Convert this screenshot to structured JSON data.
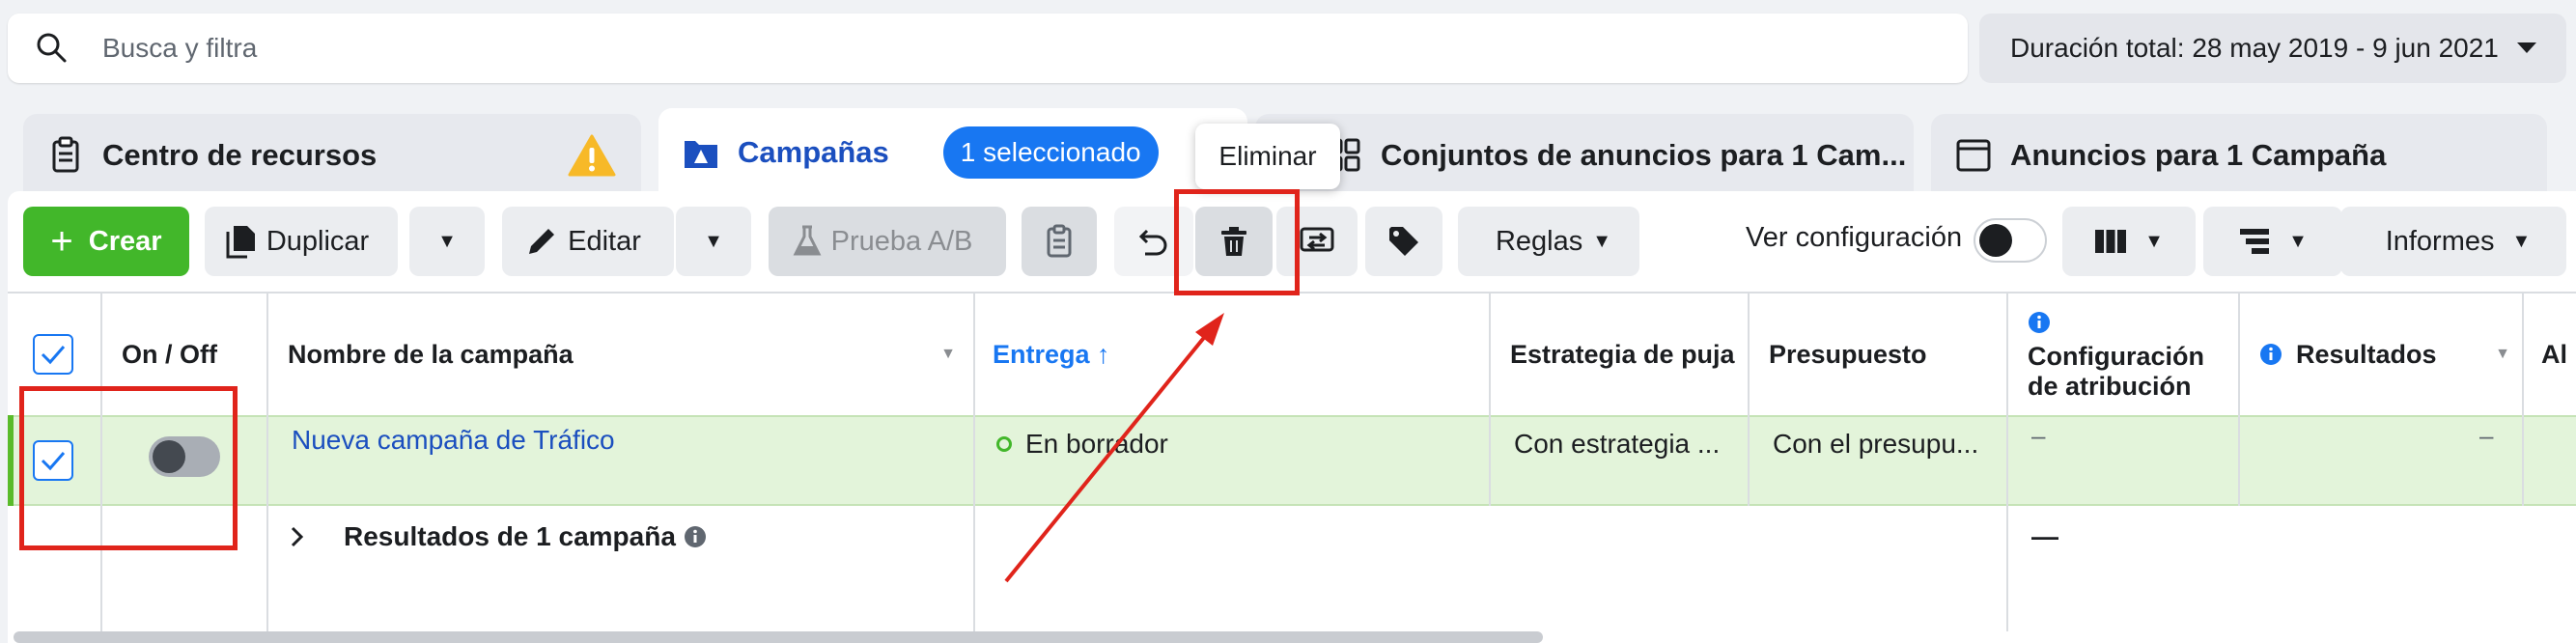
{
  "search": {
    "placeholder": "Busca y filtra"
  },
  "date_range": {
    "label": "Duración total: 28 may 2019 - 9 jun 2021"
  },
  "tabs": [
    {
      "label": "Centro de recursos"
    },
    {
      "label": "Campañas",
      "badge": "1 seleccionado"
    },
    {
      "label": "Conjuntos de anuncios para 1 Cam..."
    },
    {
      "label": "Anuncios para 1 Campaña"
    }
  ],
  "tooltip": {
    "text": "Eliminar"
  },
  "toolbar": {
    "crear": "Crear",
    "duplicar": "Duplicar",
    "editar": "Editar",
    "prueba_ab": "Prueba A/B",
    "reglas": "Reglas",
    "ver_configuracion": "Ver configuración",
    "informes": "Informes"
  },
  "table": {
    "headers": {
      "on_off": "On / Off",
      "nombre": "Nombre de la campaña",
      "entrega": "Entrega ↑",
      "estrategia": "Estrategia de puja",
      "presupuesto": "Presupuesto",
      "atribucion_1": "Configuración",
      "atribucion_2": "de atribución",
      "resultados": "Resultados",
      "alcance": "Al"
    },
    "rows": [
      {
        "nombre": "Nueva campaña de Tráfico",
        "entrega": "En borrador",
        "estrategia": "Con estrategia ...",
        "presupuesto": "Con el presupu...",
        "atribucion": "–",
        "resultados": "–"
      }
    ],
    "summary": {
      "label": "Resultados de 1 campaña",
      "atribucion": "—"
    }
  },
  "colors": {
    "accent_blue": "#1877f2",
    "create_green": "#42b72a",
    "selected_row": "#e3f4da",
    "annotation_red": "#e0241b"
  }
}
